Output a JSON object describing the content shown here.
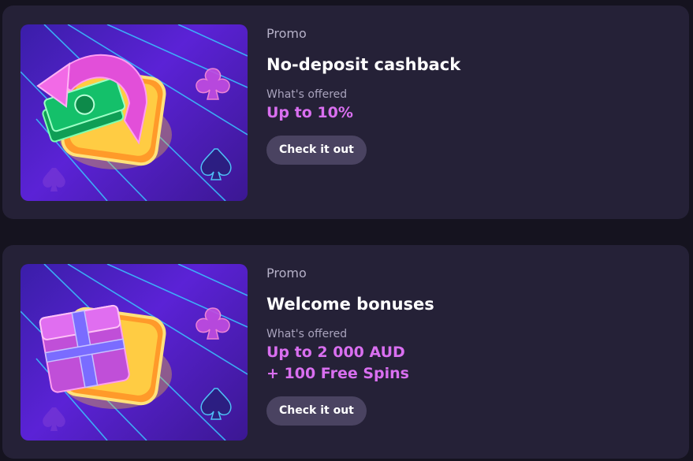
{
  "promos": [
    {
      "kicker": "Promo",
      "title": "No-deposit cashback",
      "offer_label": "What's offered",
      "offer_lines": [
        "Up to 10%"
      ],
      "cta": "Check it out",
      "art_icon": "cashback-money-icon"
    },
    {
      "kicker": "Promo",
      "title": "Welcome bonuses",
      "offer_label": "What's offered",
      "offer_lines": [
        "Up to 2 000 AUD",
        "+ 100 Free Spins"
      ],
      "cta": "Check it out",
      "art_icon": "gift-box-icon"
    }
  ],
  "colors": {
    "page_bg": "#15131f",
    "card_bg": "#252137",
    "accent": "#d96ff0",
    "button_bg": "#4a4361"
  }
}
